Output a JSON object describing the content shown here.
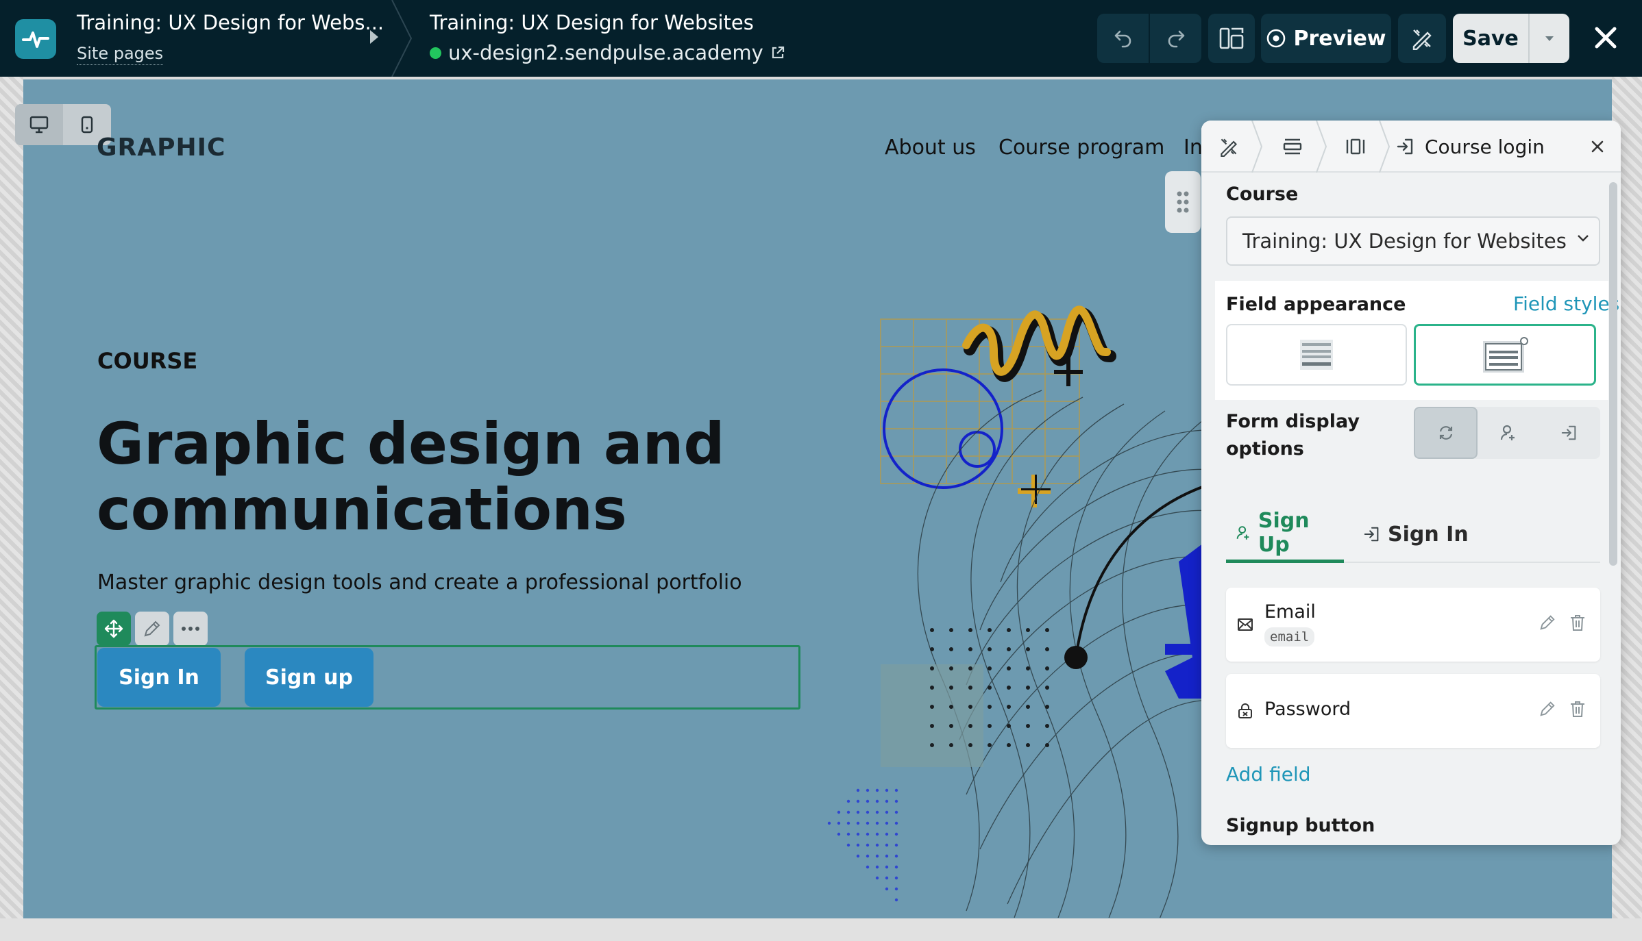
{
  "topbar": {
    "project_title": "Training: UX Design for Webs...",
    "project_sub": "Site pages",
    "page_title": "Training: UX Design for Websites",
    "page_url": "ux-design2.sendpulse.academy",
    "preview_label": "Preview",
    "save_label": "Save"
  },
  "site": {
    "brand": "GRAPHIC",
    "nav": [
      "About us",
      "Course program",
      "In"
    ],
    "eyebrow": "COURSE",
    "hero_line1": "Graphic design and",
    "hero_line2": "communications",
    "subtitle": "Master graphic design tools and create a professional portfolio",
    "btn_signin": "Sign In",
    "btn_signup": "Sign up"
  },
  "panel": {
    "tab_title": "Course login",
    "course_label": "Course",
    "course_value": "Training: UX Design for Websites",
    "appearance_label": "Field appearance",
    "field_styles": "Field styles",
    "display_label_1": "Form display",
    "display_label_2": "options",
    "tab_signup": "Sign Up",
    "tab_signin": "Sign In",
    "fields": [
      {
        "name": "Email",
        "code": "email"
      },
      {
        "name": "Password"
      }
    ],
    "add_field": "Add field",
    "signup_button": "Signup button"
  },
  "colors": {
    "accent": "#1f8a5b",
    "link": "#1f96b8",
    "topbar": "#05202b",
    "canvas": "#6d9ab0",
    "button": "#2b88c0"
  }
}
